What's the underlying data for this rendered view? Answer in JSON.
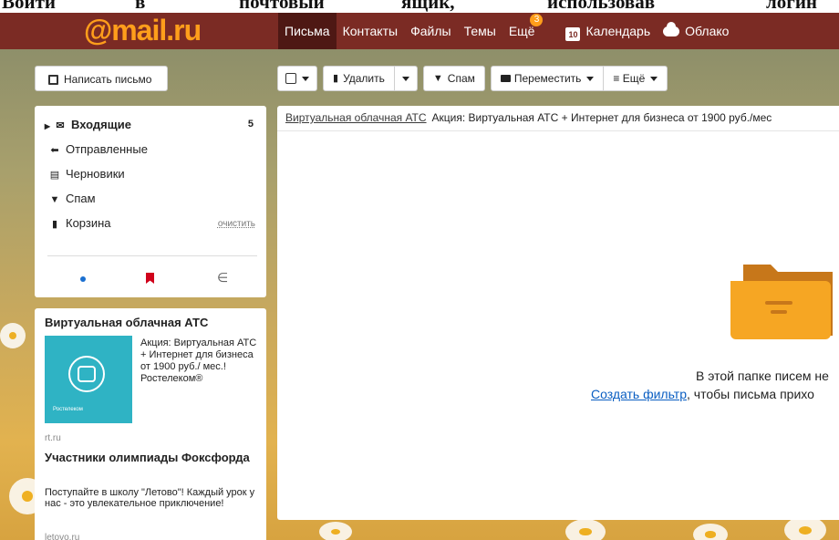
{
  "caption": {
    "words": [
      "Войти",
      "в",
      "почтовый",
      "ящик,",
      "использовав",
      "логин"
    ]
  },
  "header": {
    "logo": "@mail.ru",
    "nav": {
      "letters": "Письма",
      "contacts": "Контакты",
      "files": "Файлы",
      "themes": "Темы",
      "more": "Ещё",
      "more_badge": "3",
      "calendar": "Календарь",
      "calendar_day": "10",
      "cloud": "Облако"
    }
  },
  "compose": {
    "label": "Написать письмо"
  },
  "toolbar": {
    "delete": "Удалить",
    "spam": "Спам",
    "move": "Переместить",
    "more": "≡ Ещё"
  },
  "folders": {
    "inbox": {
      "label": "Входящие",
      "count": "5"
    },
    "sent": "Отправленные",
    "drafts": "Черновики",
    "spam": "Спам",
    "trash": "Корзина",
    "clean": "очистить"
  },
  "ads": {
    "ad1": {
      "title": "Виртуальная облачная АТС",
      "text": "Акция: Виртуальная АТС + Интернет для бизнеса от 1900 руб./ мес.! Ростелеком®",
      "brand": "Ростелеком",
      "domain": "rt.ru"
    },
    "ad2": {
      "title": "Участники олимпиады Фоксфорда",
      "text": "Поступайте в школу \"Летово\"! Каждый урок у нас - это увлекательное приключение!",
      "domain": "letovo.ru"
    }
  },
  "main": {
    "promo_sender": "Виртуальная облачная АТС",
    "promo_subject": "Акция: Виртуальная АТС + Интернет для бизнеса от 1900 руб./мес",
    "empty_line1": "В этой папке писем не",
    "empty_link": "Создать фильтр",
    "empty_line2": ", чтобы письма прихо"
  },
  "colors": {
    "topbar": "#7b2b24",
    "topbar_active": "#4e1814",
    "logo": "#ff9e1b",
    "link": "#0a5ec2",
    "folder_orange": "#f6a623"
  },
  "icons": {
    "compose": "pen-icon",
    "inbox": "envelope-icon",
    "sent": "reply-arrow-icon",
    "drafts": "document-icon",
    "spam": "thumbs-down-icon",
    "trash": "trash-icon"
  }
}
